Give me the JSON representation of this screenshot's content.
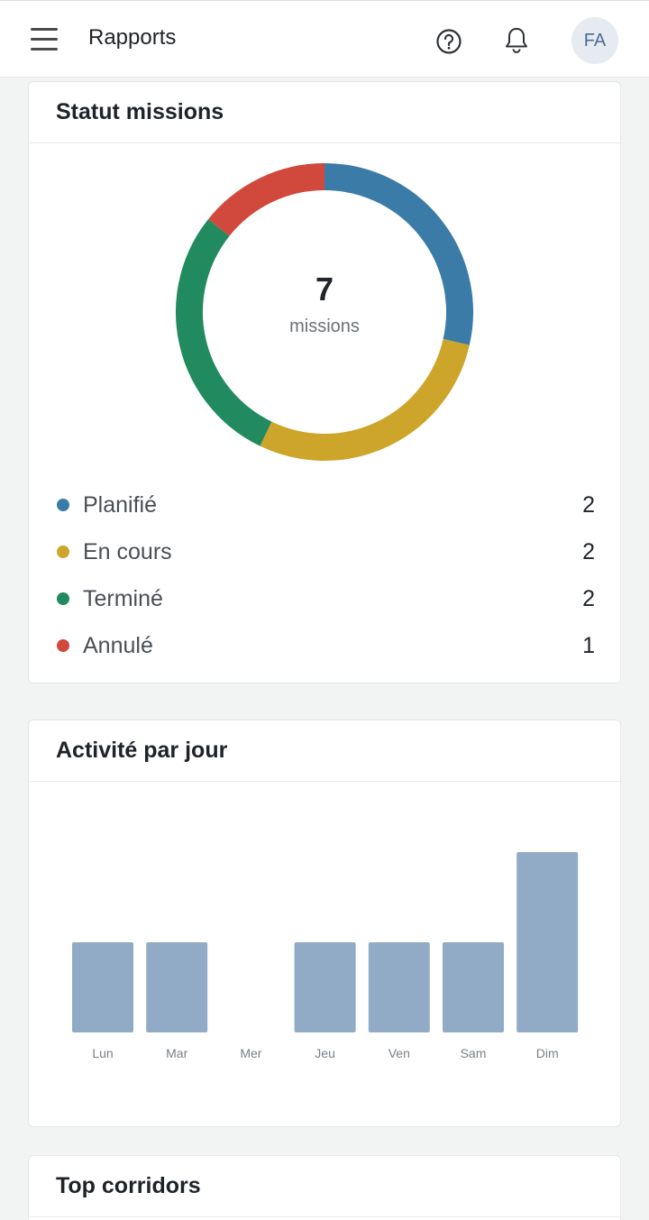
{
  "header": {
    "title": "Rapports",
    "avatar_initials": "FA",
    "icons": [
      "menu-icon",
      "help-icon",
      "bell-icon"
    ]
  },
  "status": {
    "title": "Statut missions",
    "total": "7",
    "total_label": "missions",
    "items": [
      {
        "label": "Planifié",
        "count": "2",
        "color": "#3b7ba8"
      },
      {
        "label": "En cours",
        "count": "2",
        "color": "#cda52a"
      },
      {
        "label": "Terminé",
        "count": "2",
        "color": "#218a5e"
      },
      {
        "label": "Annulé",
        "count": "1",
        "color": "#d0493c"
      }
    ]
  },
  "activity": {
    "title": "Activité par jour"
  },
  "corridors": {
    "title": "Top corridors"
  },
  "chart_data": [
    {
      "type": "pie",
      "variant": "donut",
      "categories": [
        "Planifié",
        "En cours",
        "Terminé",
        "Annulé"
      ],
      "values": [
        2,
        2,
        2,
        1
      ],
      "colors": [
        "#3b7ba8",
        "#cda52a",
        "#218a5e",
        "#d0493c"
      ]
    },
    {
      "type": "bar",
      "categories": [
        "Lun",
        "Mar",
        "Mer",
        "Jeu",
        "Ven",
        "Sam",
        "Dim"
      ],
      "values": [
        1,
        1,
        0,
        1,
        1,
        1,
        2
      ],
      "ylim": [
        0,
        2
      ],
      "bar_color": "#91abc6",
      "grid": false
    }
  ]
}
